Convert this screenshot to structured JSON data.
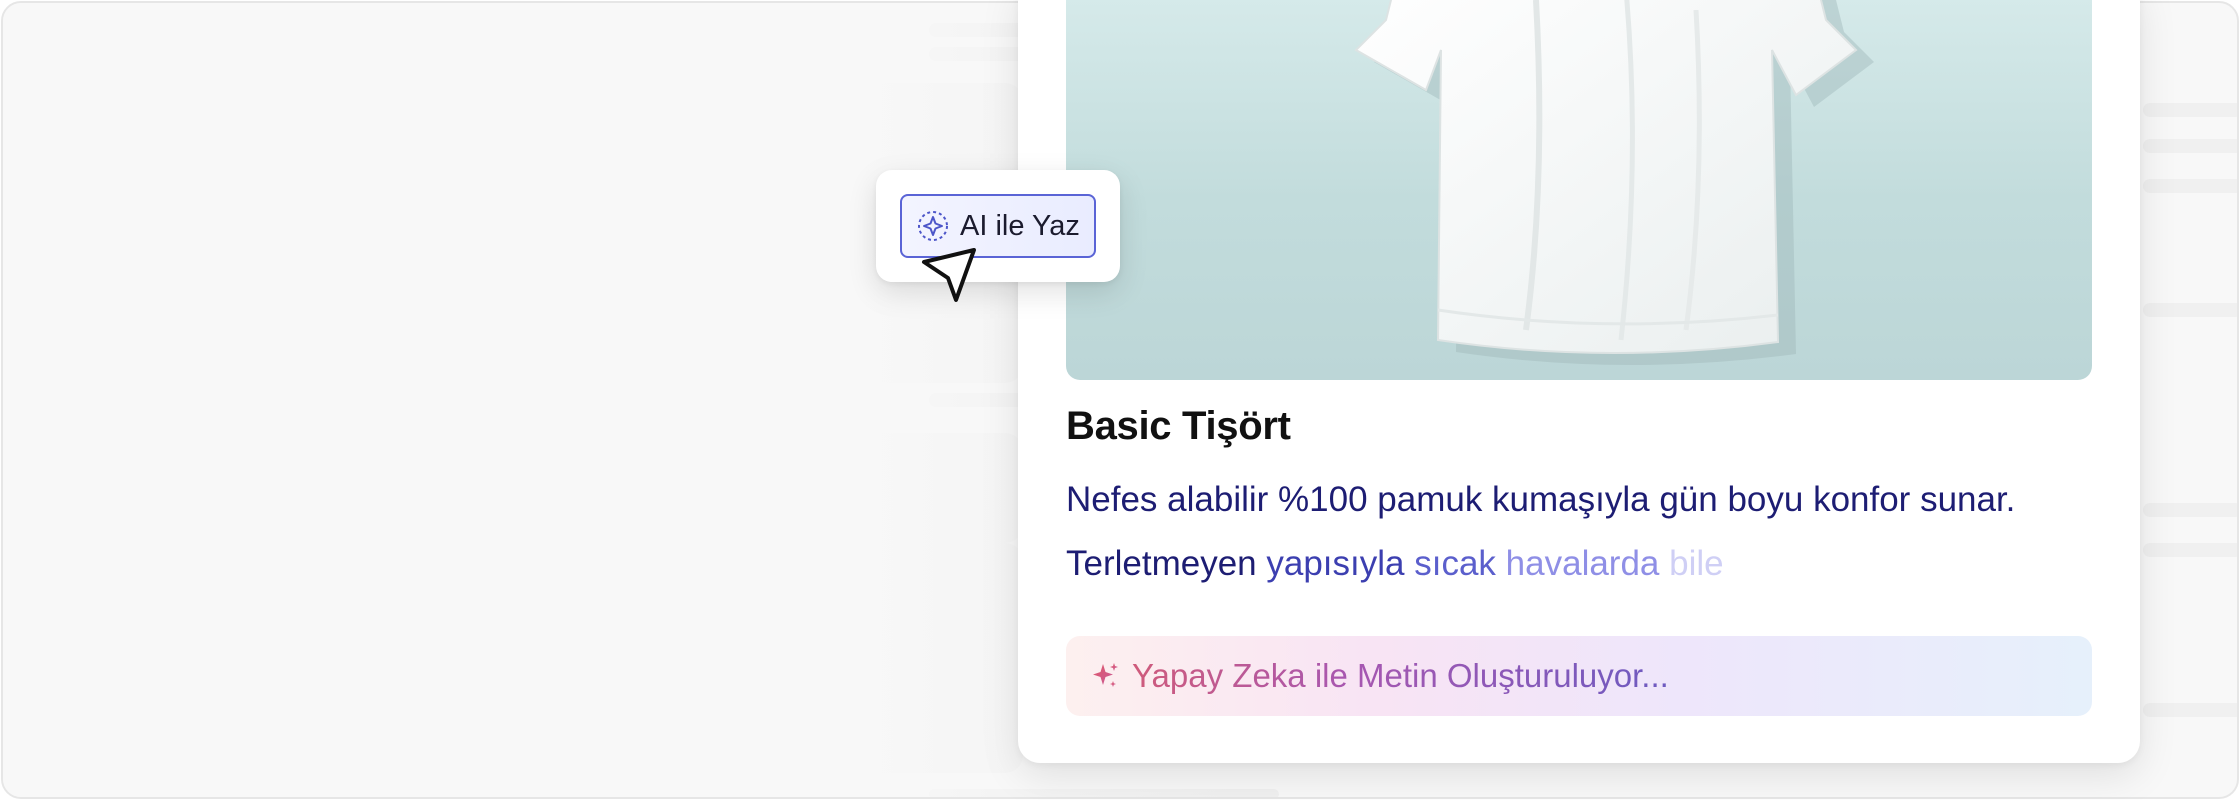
{
  "product": {
    "image_alt": "white t-shirt",
    "title": "Basic Tişört",
    "description_line1": "Nefes alabilir %100 pamuk kumaşıyla gün boyu konfor sunar.",
    "description_line2_words": [
      "Terletmeyen",
      "yapısıyla",
      "sıcak",
      "havalarda",
      "bile"
    ],
    "description_line2_colors": [
      "#1d1d73",
      "#3c3fb0",
      "#5b5fcc",
      "#8f8fe6",
      "#cfcff5"
    ]
  },
  "ai_popup": {
    "button_label": "AI ile Yaz",
    "button_icon": "sparkle-icon"
  },
  "status": {
    "icon": "sparkle-icon",
    "text": "Yapay Zeka ile Metin Oluşturuluyor..."
  },
  "colors": {
    "accent": "#5a64d6",
    "title": "#111111",
    "description": "#1d1d73"
  }
}
